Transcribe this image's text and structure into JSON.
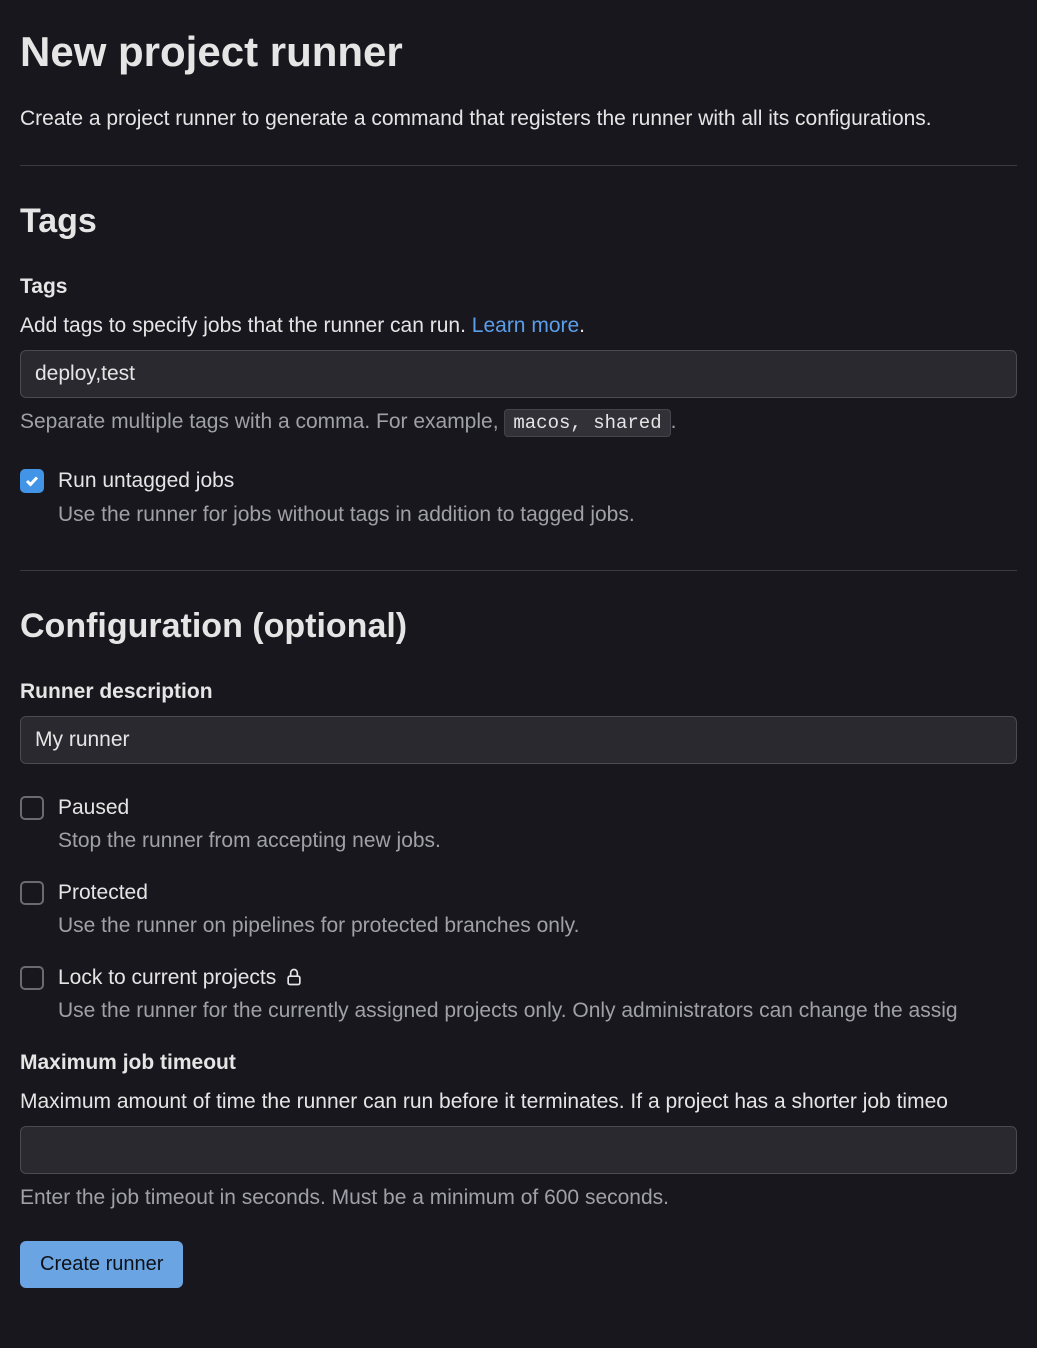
{
  "page": {
    "title": "New project runner",
    "description": "Create a project runner to generate a command that registers the runner with all its configurations."
  },
  "tags_section": {
    "header": "Tags",
    "field_label": "Tags",
    "field_hint_pre": "Add tags to specify jobs that the runner can run. ",
    "learn_more": "Learn more",
    "input_value": "deploy,test",
    "hint_below_pre": "Separate multiple tags with a comma. For example, ",
    "hint_code": "macos, shared",
    "run_untagged": {
      "label": "Run untagged jobs",
      "desc": "Use the runner for jobs without tags in addition to tagged jobs."
    }
  },
  "config_section": {
    "header": "Configuration (optional)",
    "description_label": "Runner description",
    "description_value": "My runner",
    "paused": {
      "label": "Paused",
      "desc": "Stop the runner from accepting new jobs."
    },
    "protected": {
      "label": "Protected",
      "desc": "Use the runner on pipelines for protected branches only."
    },
    "lock": {
      "label": "Lock to current projects",
      "desc": "Use the runner for the currently assigned projects only. Only administrators can change the assig"
    },
    "timeout": {
      "label": "Maximum job timeout",
      "hint_above": "Maximum amount of time the runner can run before it terminates. If a project has a shorter job timeo",
      "value": "",
      "hint_below": "Enter the job timeout in seconds. Must be a minimum of 600 seconds."
    }
  },
  "submit": {
    "label": "Create runner"
  }
}
